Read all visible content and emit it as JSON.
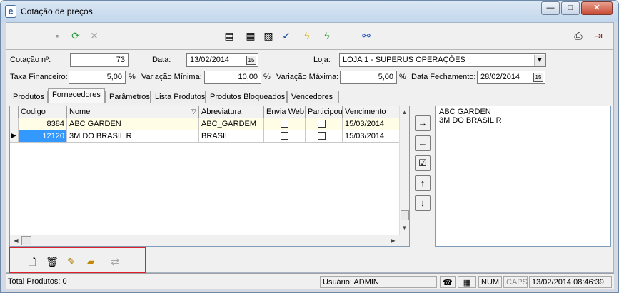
{
  "window": {
    "title": "Cotação de preços",
    "app_icon": "e",
    "minimize": "—",
    "maximize": "□",
    "close": "✕"
  },
  "toolbar": {
    "left_icons": [
      "save-icon",
      "refresh-icon",
      "cancel-icon"
    ],
    "center_icons": [
      "printer-stamp-icon",
      "calculator-icon",
      "paste-icon",
      "checklist-icon",
      "lightning-yellow-icon",
      "lightning-green-icon",
      "link-icon"
    ],
    "right_icons": [
      "print-icon",
      "exit-door-icon"
    ]
  },
  "form": {
    "cotacao_label": "Cotação nº:",
    "cotacao_value": "73",
    "data_label": "Data:",
    "data_value": "13/02/2014",
    "loja_label": "Loja:",
    "loja_value": "LOJA 1 - SUPERUS OPERAÇÕES",
    "taxa_label": "Taxa Financeiro:",
    "taxa_value": "5,00",
    "taxa_unit": "%",
    "var_min_label": "Variação Mínima:",
    "var_min_value": "10,00",
    "var_min_unit": "%",
    "var_max_label": "Variação Máxima:",
    "var_max_value": "5,00",
    "var_max_unit": "%",
    "data_fech_label": "Data Fechamento:",
    "data_fech_value": "28/02/2014",
    "calendar_glyph": "15"
  },
  "tabs": [
    {
      "label": "Produtos"
    },
    {
      "label": "Fornecedores"
    },
    {
      "label": "Parâmetros"
    },
    {
      "label": "Lista Produtos"
    },
    {
      "label": "Produtos Bloqueados"
    },
    {
      "label": "Vencedores"
    }
  ],
  "grid": {
    "columns": [
      "Codigo",
      "Nome",
      "Abreviatura",
      "Envia Web",
      "Participou",
      "Vencimento"
    ],
    "rows": [
      {
        "codigo": "8384",
        "nome": "ABC GARDEN",
        "abreviatura": "ABC_GARDEM",
        "vencimento": "15/03/2014"
      },
      {
        "codigo": "12120",
        "nome": "3M DO BRASIL R",
        "abreviatura": "BRASIL",
        "vencimento": "15/03/2014"
      }
    ]
  },
  "move_buttons": {
    "add": "→",
    "remove": "←",
    "check": "☑",
    "up": "↑",
    "down": "↓"
  },
  "selected_list": [
    "ABC GARDEN",
    "3M DO BRASIL R"
  ],
  "bottom_tools": [
    "new-document-icon",
    "trash-icon",
    "edit-pen-icon",
    "open-folder-icon",
    "transfer-icon"
  ],
  "status": {
    "total_label": "Total Produtos:",
    "total_value": "0",
    "usuario": "Usuário: ADMIN",
    "num": "NUM",
    "caps": "CAPS",
    "datetime": "13/02/2014 08:46:39"
  }
}
